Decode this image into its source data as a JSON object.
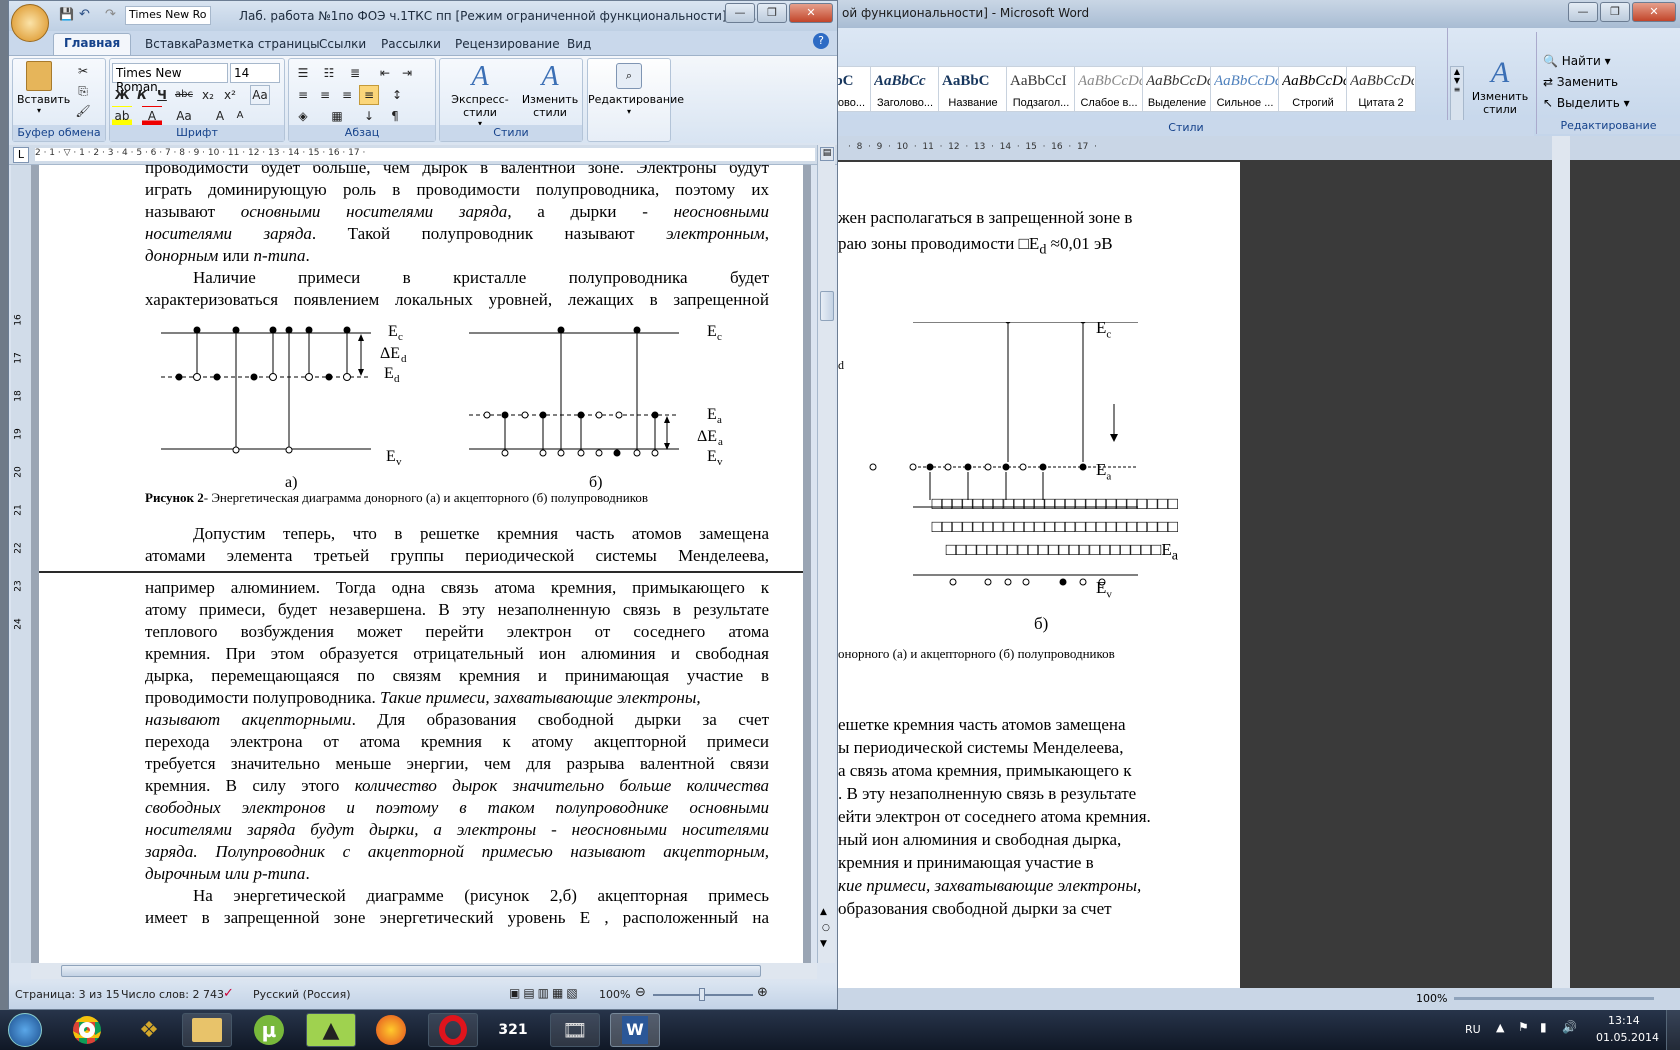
{
  "bg_window": {
    "title": "ой функциональности] - Microsoft Word",
    "styles": [
      {
        "preview": "AaBbC",
        "name": "Заголово..."
      },
      {
        "preview": "AaBbCc",
        "name": "Заголово..."
      },
      {
        "preview": "AaBbC",
        "name": "Название"
      },
      {
        "preview": "AaBbCcI",
        "name": "Подзагол..."
      },
      {
        "preview": "AaBbCcDc",
        "name": "Слабое в..."
      },
      {
        "preview": "AaBbCcDc",
        "name": "Выделение"
      },
      {
        "preview": "AaBbCcDc",
        "name": "Сильное ..."
      },
      {
        "preview": "AaBbCcDc",
        "name": "Строгий"
      },
      {
        "preview": "AaBbCcDc",
        "name": "Цитата 2"
      }
    ],
    "change_styles": "Изменить стили",
    "find": "Найти",
    "replace": "Заменить",
    "select": "Выделить",
    "styles_group": "Стили",
    "editing_group": "Редактирование",
    "ruler": "·  8  ·  9  ·  10  ·  11  ·  12  ·  13  ·  14  ·  15  ·  16  ·  17  ·",
    "lines": [
      "жен располагаться в запрещенной зоне в",
      "раю зоны проводимости ",
      "ешетке кремния часть атомов замещена",
      "ы периодической системы Менделеева,",
      "а связь атома кремния, примыкающего к",
      ". В эту незаполненную связь в результате",
      "ейти электрон от соседнего атома кремния.",
      "ный ион алюминия и свободная дырка,",
      "кремния и принимающая участие в",
      "кие примеси, захватывающие электроны,",
      "образования свободной дырки за счет"
    ],
    "delta": "□E",
    "delta_sub": "d",
    "delta_val": " ≈0,01 эВ",
    "label_d": "d",
    "caption_frag": "онорного (а) и акцепторного (б) полупроводников",
    "boxes_row": "□□□□□□□□□□□□□□□□□□□□□□□□",
    "boxes_last": "□□□□□□□□□□□□□□□□□□□□□E",
    "ea_sub": "a",
    "fig_b": "б)",
    "zoom": "100%"
  },
  "window": {
    "title": "Лаб. работа №1по ФОЭ ч.1ТКС пп [Режим ограниченной функциональности] - M...",
    "qat_font": "Times New Ro",
    "tabs": [
      "Главная",
      "Вставка",
      "Разметка страницы",
      "Ссылки",
      "Рассылки",
      "Рецензирование",
      "Вид"
    ],
    "font_name": "Times New Roman",
    "font_size": "14",
    "paste": "Вставить",
    "express_styles": "Экспресс-стили",
    "change_styles": "Изменить стили",
    "editing": "Редактирование",
    "groups": [
      "Буфер обмена",
      "Шрифт",
      "Абзац",
      "Стили"
    ],
    "ruler": "2 · 1 · ▽ · 1 · 2 · 3 · 4 · 5 · 6 · 7 · 8 · 9 · 10 · 11 · 12 · 13 · 14 · 15 · 16 · 17 ·",
    "vruler": [
      "16",
      "17",
      "18",
      "19",
      "20",
      "21",
      "22",
      "23",
      "24"
    ]
  },
  "doc": {
    "p1": [
      "проводимости будет больше, чем дырок в валентной зоне. Электроны будут",
      "играть доминирующую роль в проводимости полупроводника, поэтому их"
    ],
    "p1_l3a": "называют ",
    "p1_l3b": "основными носителями заряда",
    ", a дырки - ": "",
    "p1_l3c": ", а дырки - ",
    "p1_l3d": "неосновными",
    "p1_l4a": "носителями заряда",
    "p1_l4b": ". Такой полупроводник называют ",
    "p1_l4c": "электронным",
    "p1_l5a": "донорным",
    "p1_l5b": " или ",
    "p1_l5c": "n-типа",
    "p1_l5d": ".",
    "p2": [
      "Наличие примеси в кристалле полупроводника будет",
      "характеризоваться появлением локальных уровней, лежащих в запрещенной"
    ],
    "fig": {
      "Ec": "E",
      "Ec_sub": "c",
      "dEd": "ΔE",
      "dEd_sub": "d",
      "Ed": "E",
      "Ed_sub": "d",
      "Ea": "E",
      "Ea_sub": "a",
      "dEa": "ΔE",
      "dEa_sub": "a",
      "Ev": "E",
      "Ev_sub": "v",
      "a": "а)",
      "b": "б)"
    },
    "caption_bold": "Рисунок 2",
    "caption_rest": "- Энергетическая диаграмма донорного (а) и акцепторного (б) полупроводников",
    "p3": [
      "Допустим теперь, что в решетке кремния часть атомов замещена",
      "атомами элемента третьей группы периодической системы Менделеева,"
    ],
    "p4": [
      "например алюминием. Тогда одна связь атома кремния, примыкающего к",
      "атому примеси, будет незавершена. В эту незаполненную связь в результате",
      "теплового возбуждения может перейти электрон от соседнего атома",
      "кремния. При этом образуется отрицательный ион алюминия и свободная",
      "дырка, перемещающаяся по связям кремния и принимающая участие в"
    ],
    "p4_l6a": "проводимости полупроводника.",
    "p4_l6b": "Такие примеси, захватывающие электроны,",
    "p4_l7a": "называют акцепторными",
    "p4_l7b": ". Для образования свободной дырки за счет",
    "p4_more": [
      "перехода электрона от атома кремния к атому акцепторной примеси",
      "требуется значительно меньше энергии, чем для разрыва валентной связи"
    ],
    "p4_l10a": "кремния. В силу этого ",
    "p4_l10b": "количество дырок значительно больше количества",
    "p4_it": [
      "свободных электронов и поэтому в таком полупроводнике основными",
      "носителями заряда будут дырки, а электроны - неосновными носителями",
      "заряда. Полупроводник с акцепторной примесью называют акцепторным,"
    ],
    "p4_last": "дырочным или p-типа",
    "p5": "На энергетической диаграмме (рисунок 2,б) акцепторная примесь",
    "p5b": "имеет в запрещенной зоне энергетический уровень E , расположенный на"
  },
  "status": {
    "page": "Страница: 3 из 15",
    "words": "Число слов: 2 743",
    "lang": "Русский (Россия)",
    "zoom": "100%"
  },
  "taskbar": {
    "lang": "RU",
    "time": "13:14",
    "date": "01.05.2014"
  }
}
